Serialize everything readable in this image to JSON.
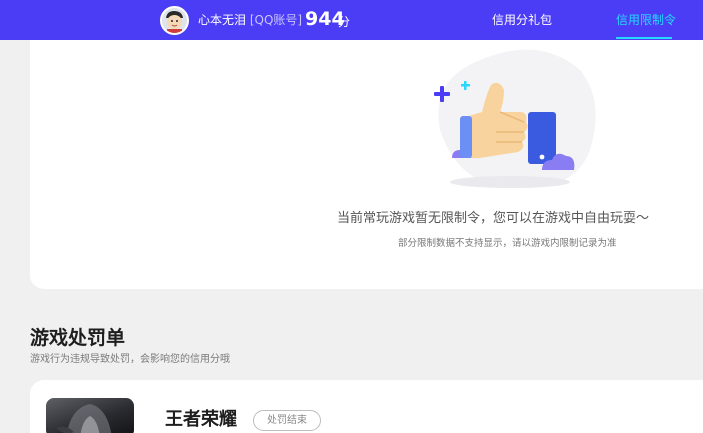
{
  "header": {
    "username": "心本无泪",
    "account_type": "[QQ账号]",
    "score": "944",
    "score_unit": "分",
    "nav": {
      "gift_label": "信用分礼包",
      "limit_label": "信用限制令"
    },
    "colors": {
      "bar": "#4b3cf5",
      "active_nav": "#27d9ff"
    }
  },
  "limit_card": {
    "illustration": "thumbs-up-illustration",
    "empty_message": "当前常玩游戏暂无限制令，您可以在游戏中自由玩耍～",
    "note": "部分限制数据不支持显示，请以游戏内限制记录为准"
  },
  "penalty_section": {
    "title": "游戏处罚单",
    "description": "游戏行为违规导致处罚，会影响您的信用分哦",
    "items": [
      {
        "game": "王者荣耀",
        "status": "处罚结束"
      }
    ]
  }
}
